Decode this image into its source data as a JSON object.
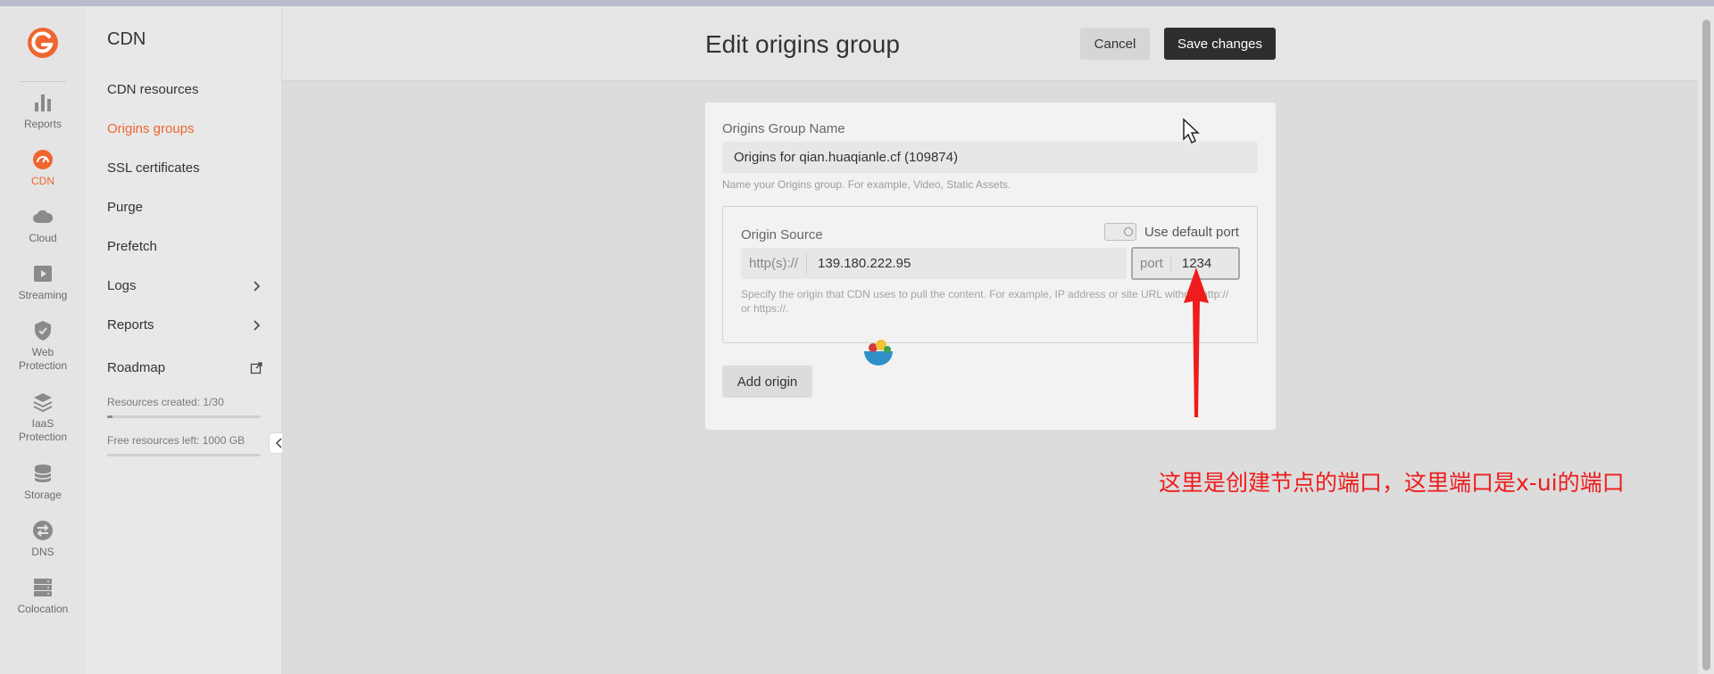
{
  "rail": {
    "items": [
      {
        "label": "Reports",
        "icon": "bar-chart-icon"
      },
      {
        "label": "CDN",
        "icon": "speedometer-icon",
        "active": true
      },
      {
        "label": "Cloud",
        "icon": "cloud-icon"
      },
      {
        "label": "Streaming",
        "icon": "play-icon"
      },
      {
        "label": "Web Protection",
        "icon": "shield-icon"
      },
      {
        "label": "IaaS Protection",
        "icon": "layers-icon"
      },
      {
        "label": "Storage",
        "icon": "database-icon"
      },
      {
        "label": "DNS",
        "icon": "swap-icon"
      },
      {
        "label": "Colocation",
        "icon": "server-icon"
      }
    ]
  },
  "sidebar": {
    "title": "CDN",
    "items": [
      {
        "label": "CDN resources"
      },
      {
        "label": "Origins groups",
        "active": true
      },
      {
        "label": "SSL certificates"
      },
      {
        "label": "Purge"
      },
      {
        "label": "Prefetch"
      },
      {
        "label": "Logs",
        "chevron": true
      },
      {
        "label": "Reports",
        "chevron": true
      },
      {
        "label": "Roadmap",
        "external": true
      }
    ],
    "resources_created": "Resources created: 1/30",
    "resources_created_fraction": 0.033,
    "free_resources": "Free resources left: 1000 GB",
    "free_resources_fraction": 0
  },
  "header": {
    "title": "Edit origins group",
    "cancel_label": "Cancel",
    "save_label": "Save changes"
  },
  "form": {
    "group_name_label": "Origins Group Name",
    "group_name_value": "Origins for qian.huaqianle.cf (109874)",
    "group_name_hint": "Name your Origins group. For example, Video, Static Assets.",
    "origin_source_label": "Origin Source",
    "use_default_port_label": "Use default port",
    "scheme_prefix": "http(s)://",
    "origin_value": "139.180.222.95",
    "port_prefix": "port",
    "port_value": "1234",
    "origin_hint": "Specify the origin that CDN uses to pull the content. For example, IP address or site URL without http:// or https://.",
    "add_origin_label": "Add origin"
  },
  "annotation": {
    "text": "这里是创建节点的端口，这里端口是x-ui的端口",
    "color": "#ee1c1c"
  },
  "colors": {
    "accent": "#f0652f",
    "primary_button": "#2e2e2e"
  }
}
